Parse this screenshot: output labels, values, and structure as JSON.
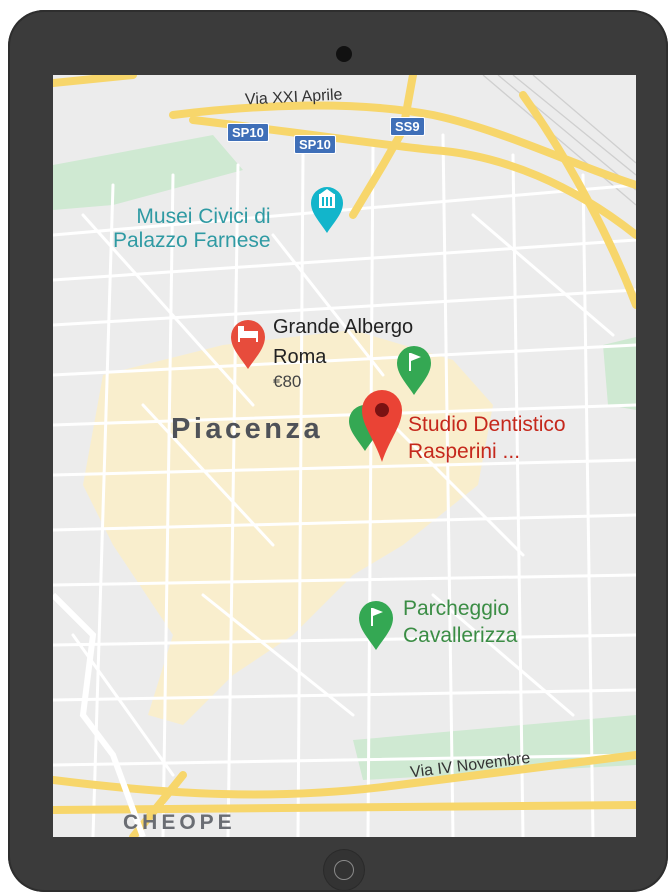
{
  "map": {
    "city": "Piacenza",
    "district": "CHEOPE",
    "roads": {
      "top": "Via XXI Aprile",
      "bottom": "Via IV Novembre"
    },
    "shields": [
      "SP10",
      "SP10",
      "SS9"
    ],
    "pois": {
      "museum": {
        "line1": "Musei Civici di",
        "line2": "Palazzo Farnese",
        "icon": "museum-icon"
      },
      "hotel": {
        "line1": "Grande Albergo",
        "line2": "Roma",
        "price": "€80",
        "icon": "bed-icon"
      },
      "dentist": {
        "line1": "Studio Dentistico",
        "line2": "Rasperini ...",
        "icon": "map-pin-icon"
      },
      "parking": {
        "line1": "Parcheggio",
        "line2": "Cavallerizza",
        "icon": "flag-icon"
      }
    },
    "colors": {
      "land": "#ececec",
      "major_road": "#f7d66b",
      "minor_road": "#ffffff",
      "park": "#cce8cf",
      "old_town": "#fbefc8",
      "selected_pin": "#ea4335",
      "park_pin": "#34a853",
      "museum_pin": "#12b5cb"
    }
  }
}
